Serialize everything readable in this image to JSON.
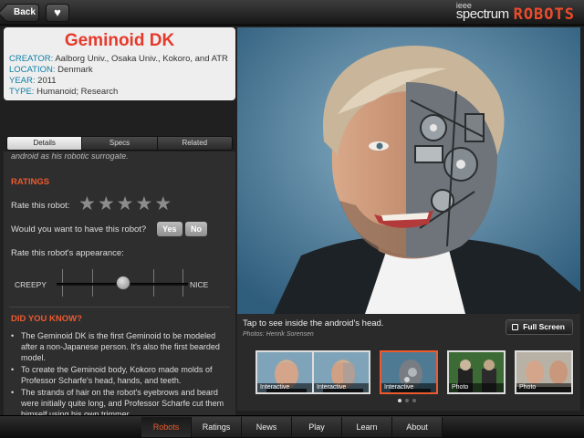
{
  "topbar": {
    "back_label": "Back",
    "favorite_icon": "heart-icon",
    "logo_small": "ieee",
    "logo_main": "spectrum",
    "logo_brand": "ROBOTS"
  },
  "robot": {
    "name": "Geminoid DK",
    "creator_key": "CREATOR:",
    "creator": "Aalborg Univ., Osaka Univ., Kokoro, and ATR",
    "location_key": "LOCATION:",
    "location": "Denmark",
    "year_key": "YEAR:",
    "year": "2011",
    "type_key": "TYPE:",
    "type": "Humanoid; Research"
  },
  "tabs": [
    {
      "label": "Details"
    },
    {
      "label": "Specs"
    },
    {
      "label": "Related"
    }
  ],
  "details": {
    "cut_text": "android as his robotic surrogate.",
    "ratings_title": "RATINGS",
    "rate_label": "Rate this robot:",
    "star_rating": 0,
    "want_label": "Would you want to have this robot?",
    "yes_label": "Yes",
    "no_label": "No",
    "appearance_label": "Rate this robot's appearance:",
    "creepy_label": "CREEPY",
    "nice_label": "NICE",
    "appearance_value": 0.5,
    "didyouknow_title": "DID YOU KNOW?",
    "facts": [
      "The Geminoid DK is the first Geminoid to be modeled after a non-Japanese person. It's also the first bearded model.",
      "To create the Geminoid body, Kokoro made molds of Professor Scharfe's head, hands, and teeth.",
      "The strands of hair on the robot's eyebrows and beard were initially quite long, and Professor Scharfe cut them himself using his own trimmer."
    ]
  },
  "media": {
    "caption": "Tap to see inside the android's head.",
    "credit": "Photos: Henrik Sorensen",
    "fullscreen_label": "Full Screen",
    "thumbnails": [
      {
        "label": "Interactive"
      },
      {
        "label": "Interactive"
      },
      {
        "label": "Interactive"
      },
      {
        "label": "Photo"
      },
      {
        "label": "Photo"
      }
    ],
    "page_count": 3,
    "current_page": 1
  },
  "nav": [
    {
      "label": "Robots"
    },
    {
      "label": "Ratings"
    },
    {
      "label": "News"
    },
    {
      "label": "Play"
    },
    {
      "label": "Learn"
    },
    {
      "label": "About"
    }
  ],
  "colors": {
    "accent": "#ee5a2e",
    "title_red": "#e5392a",
    "meta_key_blue": "#0f7fa8"
  }
}
